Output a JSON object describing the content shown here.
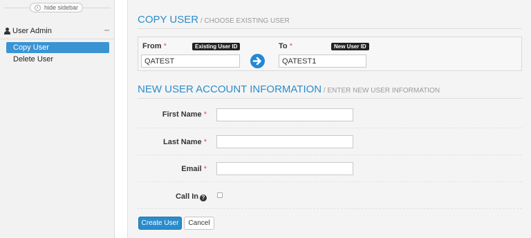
{
  "sidebar": {
    "hide_label": "hide sidebar",
    "module_label": "User Admin",
    "items": [
      {
        "label": "Copy User",
        "active": true
      },
      {
        "label": "Delete User",
        "active": false
      }
    ]
  },
  "copy_section": {
    "title": "COPY USER",
    "subtitle": " / CHOOSE EXISTING USER",
    "from_label": "From",
    "from_tag": "Existing User ID",
    "from_value": "QATEST",
    "to_label": "To",
    "to_tag": "New User ID",
    "to_value": "QATEST1",
    "required_mark": "*"
  },
  "info_section": {
    "title": "NEW USER ACCOUNT INFORMATION",
    "subtitle": " / ENTER NEW USER INFORMATION",
    "fields": [
      {
        "label": "First Name",
        "value": ""
      },
      {
        "label": "Last Name",
        "value": ""
      },
      {
        "label": "Email",
        "value": ""
      }
    ],
    "call_in_label": "Call In",
    "call_in_checked": false
  },
  "actions": {
    "create_label": "Create User",
    "cancel_label": "Cancel"
  },
  "colors": {
    "accent": "#2a8ccc",
    "required": "#d9534f",
    "active_nav": "#3a94d4"
  },
  "icons": [
    "user-icon",
    "chevron-left-icon",
    "arrow-right-circle-icon",
    "question-circle-icon",
    "collapse-icon"
  ]
}
